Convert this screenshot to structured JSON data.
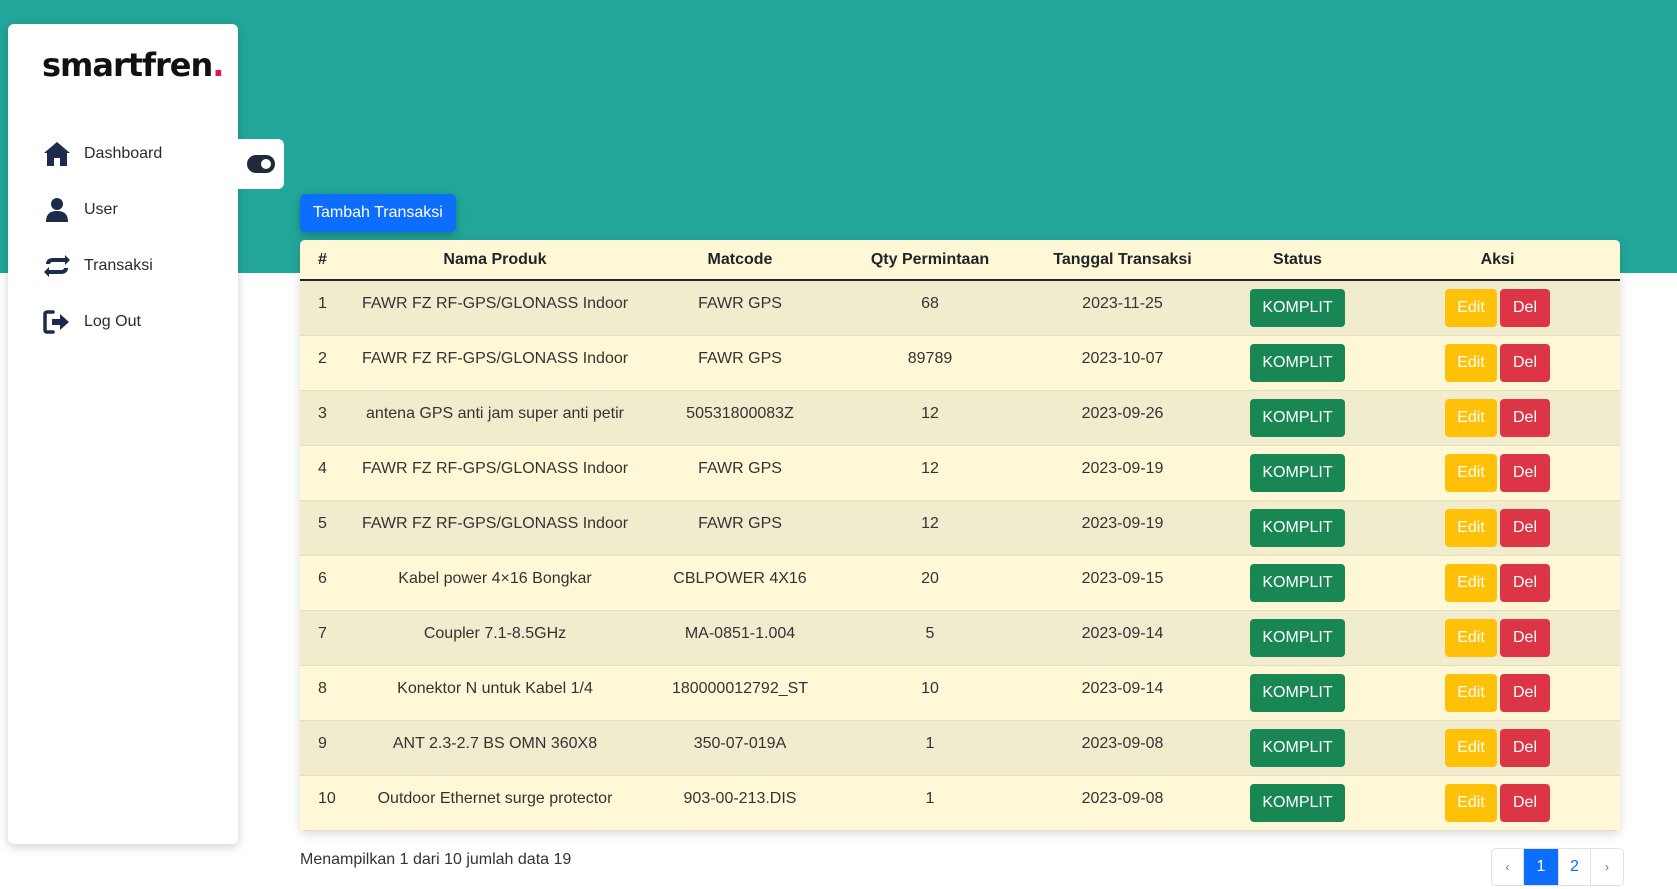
{
  "brand": {
    "name": "smartfren",
    "dot": "."
  },
  "sidebar": {
    "items": [
      {
        "label": "Dashboard",
        "icon": "home-icon"
      },
      {
        "label": "User",
        "icon": "user-icon"
      },
      {
        "label": "Transaksi",
        "icon": "exchange-icon"
      },
      {
        "label": "Log Out",
        "icon": "logout-icon"
      }
    ]
  },
  "toolbar": {
    "add_label": "Tambah Transaksi"
  },
  "table": {
    "headers": [
      "#",
      "Nama Produk",
      "Matcode",
      "Qty Permintaan",
      "Tanggal Transaksi",
      "Status",
      "Aksi"
    ],
    "rows": [
      {
        "no": "1",
        "produk": "FAWR FZ RF-GPS/GLONASS Indoor",
        "matcode": "FAWR GPS",
        "qty": "68",
        "tanggal": "2023-11-25",
        "status": "KOMPLIT"
      },
      {
        "no": "2",
        "produk": "FAWR FZ RF-GPS/GLONASS Indoor",
        "matcode": "FAWR GPS",
        "qty": "89789",
        "tanggal": "2023-10-07",
        "status": "KOMPLIT"
      },
      {
        "no": "3",
        "produk": "antena GPS anti jam super anti petir",
        "matcode": "50531800083Z",
        "qty": "12",
        "tanggal": "2023-09-26",
        "status": "KOMPLIT"
      },
      {
        "no": "4",
        "produk": "FAWR FZ RF-GPS/GLONASS Indoor",
        "matcode": "FAWR GPS",
        "qty": "12",
        "tanggal": "2023-09-19",
        "status": "KOMPLIT"
      },
      {
        "no": "5",
        "produk": "FAWR FZ RF-GPS/GLONASS Indoor",
        "matcode": "FAWR GPS",
        "qty": "12",
        "tanggal": "2023-09-19",
        "status": "KOMPLIT"
      },
      {
        "no": "6",
        "produk": "Kabel power 4×16 Bongkar",
        "matcode": "CBLPOWER 4X16",
        "qty": "20",
        "tanggal": "2023-09-15",
        "status": "KOMPLIT"
      },
      {
        "no": "7",
        "produk": "Coupler 7.1-8.5GHz",
        "matcode": "MA-0851-1.004",
        "qty": "5",
        "tanggal": "2023-09-14",
        "status": "KOMPLIT"
      },
      {
        "no": "8",
        "produk": "Konektor N untuk Kabel 1/4",
        "matcode": "180000012792_ST",
        "qty": "10",
        "tanggal": "2023-09-14",
        "status": "KOMPLIT"
      },
      {
        "no": "9",
        "produk": "ANT 2.3-2.7 BS OMN 360X8",
        "matcode": "350-07-019A",
        "qty": "1",
        "tanggal": "2023-09-08",
        "status": "KOMPLIT"
      },
      {
        "no": "10",
        "produk": "Outdoor Ethernet surge protector",
        "matcode": "903-00-213.DIS",
        "qty": "1",
        "tanggal": "2023-09-08",
        "status": "KOMPLIT"
      }
    ],
    "edit_label": "Edit",
    "del_label": "Del"
  },
  "footer": {
    "summary": "Menampilkan 1 dari 10 jumlah data 19"
  },
  "pagination": {
    "prev": "‹",
    "pages": [
      "1",
      "2"
    ],
    "active": "1",
    "next": "›"
  },
  "colors": {
    "header_band": "#21a699",
    "primary": "#0d6efd",
    "success": "#198754",
    "warning": "#ffc107",
    "danger": "#dc3545",
    "brand_dot": "#e5125d"
  }
}
